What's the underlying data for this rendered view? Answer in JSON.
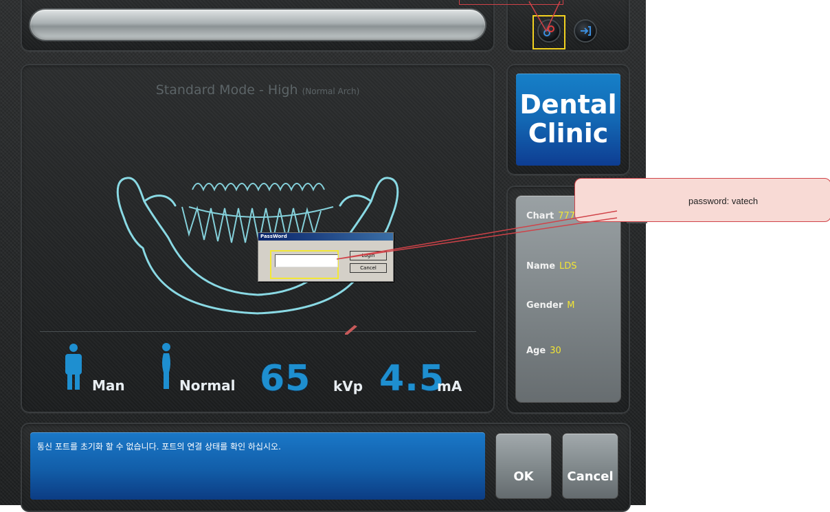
{
  "header": {
    "search_value": "",
    "icons": [
      "link-icon",
      "logout-icon"
    ]
  },
  "main": {
    "mode_title": "Standard Mode - High",
    "mode_sub": "(Normal Arch)",
    "patient_sex": "Man",
    "patient_body": "Normal",
    "kvp_value": "65",
    "kvp_unit": "kVp",
    "ma_value": "4.5",
    "ma_unit": "mA"
  },
  "logo": {
    "line1": "Dental",
    "line2": "Clinic"
  },
  "patient": {
    "chart_label": "Chart",
    "chart_value": "777",
    "name_label": "Name",
    "name_value": "LDS",
    "gender_label": "Gender",
    "gender_value": "M",
    "age_label": "Age",
    "age_value": "30"
  },
  "message": {
    "text": "통신 포트를 초기화 할 수 없습니다. 포트의 연결 상태를 확인 하십시오."
  },
  "buttons": {
    "ok": "OK",
    "cancel": "Cancel"
  },
  "dialog": {
    "title": "PassWord",
    "password_value": "",
    "login": "Login",
    "cancel": "Cancel"
  },
  "callout": {
    "text": "password: vatech"
  },
  "colors": {
    "accent_blue": "#1e8fd0",
    "value_yellow": "#f2e534",
    "highlight_yellow": "#f3d21f",
    "annotation_red": "#d04248"
  }
}
